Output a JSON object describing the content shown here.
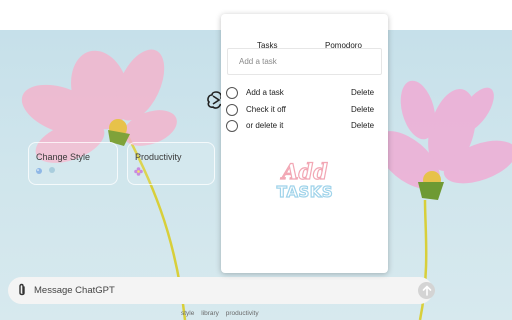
{
  "chat": {
    "cards": [
      {
        "title": "Change Style",
        "icon": "palette-icon"
      },
      {
        "title": "Productivity",
        "icon": "flower-icon"
      }
    ],
    "composer": {
      "placeholder": "Message ChatGPT"
    },
    "footer_links": [
      "style",
      "library",
      "productivity"
    ]
  },
  "panel": {
    "tabs": [
      "Tasks",
      "Pomodoro"
    ],
    "task_input_placeholder": "Add a task",
    "tasks": [
      {
        "label": "Add a task",
        "done": false,
        "delete_label": "Delete"
      },
      {
        "label": "Check it off",
        "done": false,
        "delete_label": "Delete"
      },
      {
        "label": "or delete it",
        "done": false,
        "delete_label": "Delete"
      }
    ],
    "empty_art": {
      "line1": "Add",
      "line2": "TASKS"
    }
  },
  "colors": {
    "background_sky": "#cfe5ec",
    "flower_pink": "#f4b6cf",
    "stem_yellow": "#e3d23a",
    "art_pink": "#f2a7b4",
    "art_blue": "#9fd3ea"
  }
}
